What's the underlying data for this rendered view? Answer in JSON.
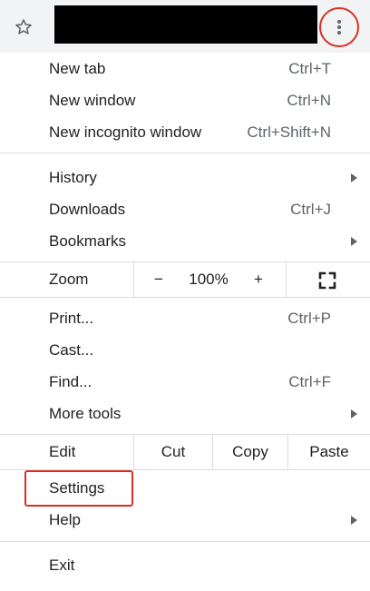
{
  "toolbar": {
    "bookmark_icon": "star-outline-icon",
    "menu_icon": "vertical-dots-icon",
    "address_bar": ""
  },
  "menu": {
    "new_tab": {
      "label": "New tab",
      "shortcut": "Ctrl+T"
    },
    "new_window": {
      "label": "New window",
      "shortcut": "Ctrl+N"
    },
    "new_incognito": {
      "label": "New incognito window",
      "shortcut": "Ctrl+Shift+N"
    },
    "history": {
      "label": "History"
    },
    "downloads": {
      "label": "Downloads",
      "shortcut": "Ctrl+J"
    },
    "bookmarks": {
      "label": "Bookmarks"
    },
    "zoom": {
      "label": "Zoom",
      "minus": "−",
      "value": "100%",
      "plus": "+",
      "fullscreen_icon": "fullscreen-icon"
    },
    "print": {
      "label": "Print...",
      "shortcut": "Ctrl+P"
    },
    "cast": {
      "label": "Cast..."
    },
    "find": {
      "label": "Find...",
      "shortcut": "Ctrl+F"
    },
    "more_tools": {
      "label": "More tools"
    },
    "edit": {
      "label": "Edit",
      "cut": "Cut",
      "copy": "Copy",
      "paste": "Paste"
    },
    "settings": {
      "label": "Settings"
    },
    "help": {
      "label": "Help"
    },
    "exit": {
      "label": "Exit"
    }
  },
  "colors": {
    "highlight": "#d93025",
    "text": "#202124",
    "secondary_text": "#5f6368",
    "divider": "#dadce0"
  }
}
